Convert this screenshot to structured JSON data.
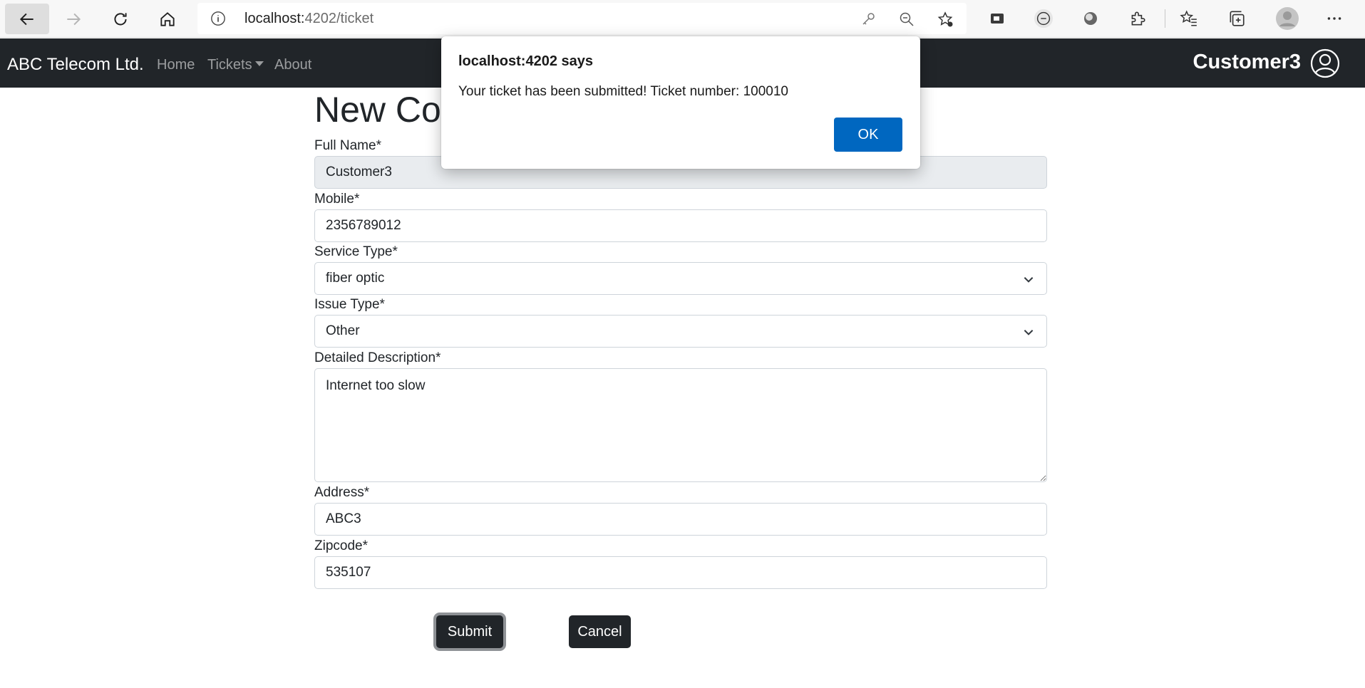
{
  "browser": {
    "url_host": "localhost:",
    "url_port_path": "4202/ticket"
  },
  "navbar": {
    "brand": "ABC Telecom Ltd.",
    "links": [
      "Home",
      "Tickets",
      "About"
    ],
    "user_name": "Customer3"
  },
  "form": {
    "title": "New Complaint",
    "full_name_label": "Full Name*",
    "full_name_value": "Customer3",
    "mobile_label": "Mobile*",
    "mobile_value": "2356789012",
    "service_type_label": "Service Type*",
    "service_type_value": "fiber optic",
    "issue_type_label": "Issue Type*",
    "issue_type_value": "Other",
    "description_label": "Detailed Description*",
    "description_value": "Internet too slow",
    "address_label": "Address*",
    "address_value": "ABC3",
    "zipcode_label": "Zipcode*",
    "zipcode_value": "535107",
    "submit_label": "Submit",
    "cancel_label": "Cancel"
  },
  "dialog": {
    "title": "localhost:4202 says",
    "message": "Your ticket has been submitted! Ticket number: 100010",
    "ok_label": "OK"
  },
  "colors": {
    "navbar_bg": "#212529",
    "dialog_ok": "#0067c0",
    "disabled_field": "#e9ecef"
  },
  "icons": [
    "back-icon",
    "forward-icon",
    "refresh-icon",
    "home-icon",
    "info-icon",
    "key-icon",
    "zoom-out-icon",
    "add-favorite-icon",
    "extension-icons",
    "favorites-icon",
    "collections-icon",
    "profile-icon",
    "more-icon",
    "user-circle-icon",
    "chevron-down-icon"
  ]
}
